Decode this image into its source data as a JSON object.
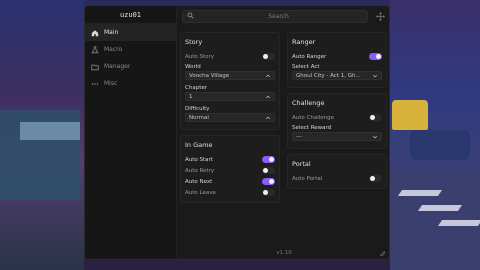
{
  "colors": {
    "accent": "#8b5cf6",
    "window_bg": "#1a1a1a",
    "sidebar_bg": "#161616"
  },
  "app": {
    "title": "uzu01",
    "version": "v1.10"
  },
  "sidebar": {
    "items": [
      {
        "label": "Main",
        "icon": "home-icon",
        "active": true
      },
      {
        "label": "Macro",
        "icon": "flask-icon",
        "active": false
      },
      {
        "label": "Manager",
        "icon": "folder-icon",
        "active": false
      },
      {
        "label": "Misc",
        "icon": "dots-icon",
        "active": false
      }
    ]
  },
  "search": {
    "placeholder": "Search"
  },
  "story": {
    "title": "Story",
    "auto_story_label": "Auto Story",
    "auto_story": false,
    "world_label": "World",
    "world_value": "Voocha Village",
    "chapter_label": "Chapter",
    "chapter_value": "1",
    "difficulty_label": "Difficulty",
    "difficulty_value": "Normal"
  },
  "ingame": {
    "title": "In Game",
    "auto_start_label": "Auto Start",
    "auto_start": true,
    "auto_retry_label": "Auto Retry",
    "auto_retry": false,
    "auto_next_label": "Auto Next",
    "auto_next": true,
    "auto_leave_label": "Auto Leave",
    "auto_leave": false
  },
  "ranger": {
    "title": "Ranger",
    "auto_ranger_label": "Auto Ranger",
    "auto_ranger": true,
    "select_act_label": "Select Act",
    "select_act_value": "Ghoul City - Act 1, Gh..."
  },
  "challenge": {
    "title": "Challenge",
    "auto_challenge_label": "Auto Challenge",
    "auto_challenge": false,
    "select_reward_label": "Select Reward",
    "select_reward_value": "---"
  },
  "portal": {
    "title": "Portal",
    "auto_portal_label": "Auto Portal",
    "auto_portal": false
  }
}
